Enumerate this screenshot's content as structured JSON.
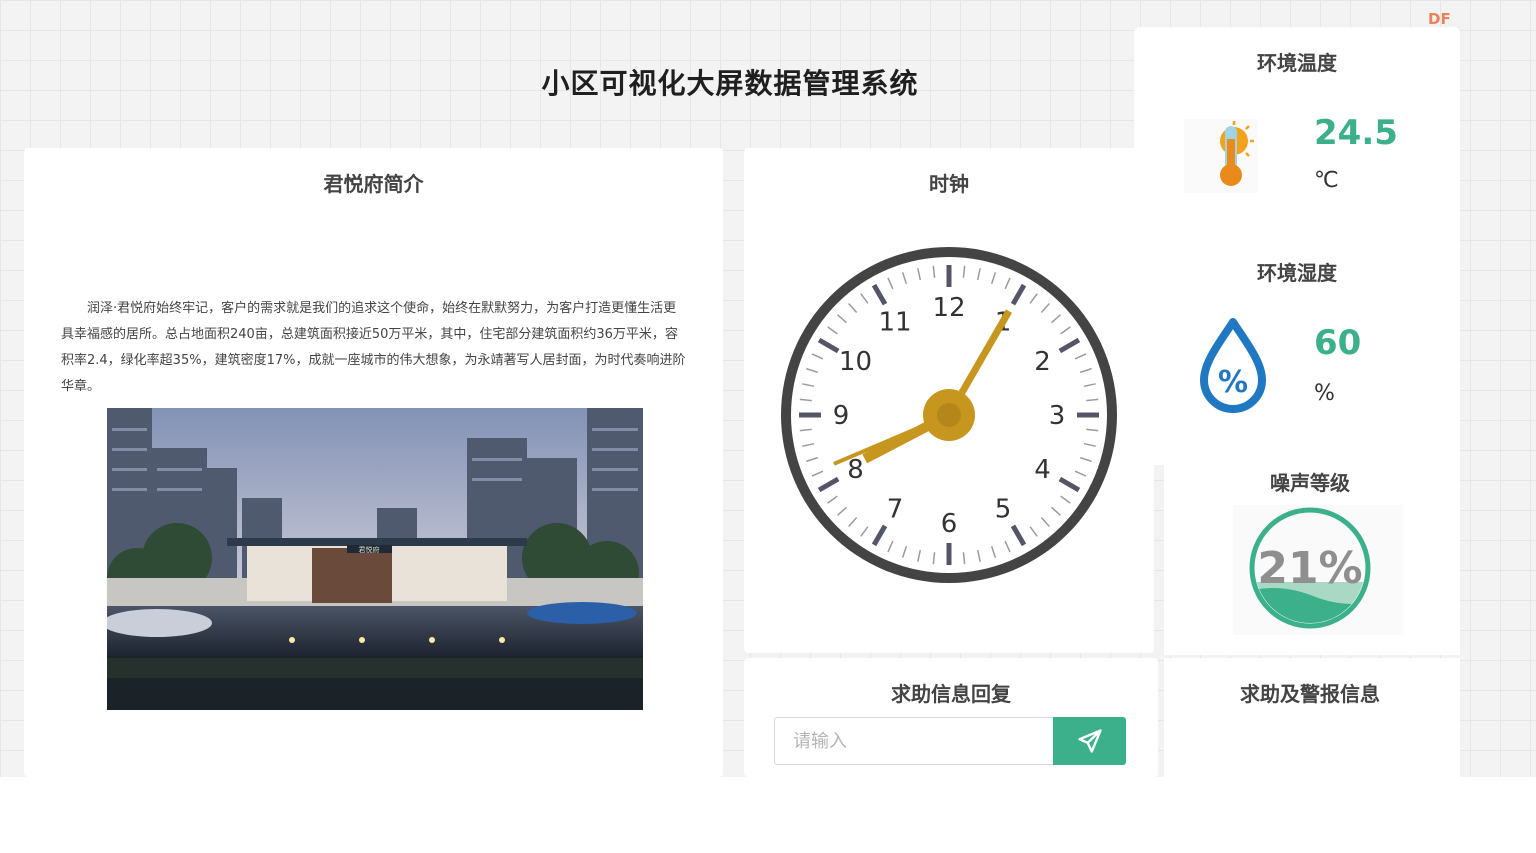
{
  "page": {
    "title": "小区可视化大屏数据管理系统",
    "badge": "DF"
  },
  "intro": {
    "title": "君悦府简介",
    "text": "润泽·君悦府始终牢记，客户的需求就是我们的追求这个使命，始终在默默努力，为客户打造更懂生活更具幸福感的居所。总占地面积240亩，总建筑面积接近50万平米，其中，住宅部分建筑面积约36万平米，容积率2.4，绿化率超35%，建筑密度17%，成就一座城市的伟大想象，为永靖著写人居封面，为时代奏响进阶华章。",
    "photo_sign": "君悦府"
  },
  "clock": {
    "title": "时钟",
    "numbers": [
      "12",
      "1",
      "2",
      "3",
      "4",
      "5",
      "6",
      "7",
      "8",
      "9",
      "10",
      "11"
    ],
    "time": {
      "hour": 8,
      "minute": 5
    },
    "colors": {
      "hand": "#c7961e",
      "rim": "#444444"
    }
  },
  "environment": {
    "temperature": {
      "title": "环境温度",
      "value": "24.5",
      "unit": "℃",
      "icon": "thermometer-icon"
    },
    "humidity": {
      "title": "环境湿度",
      "value": "60",
      "unit": "%",
      "icon": "water-drop-icon"
    },
    "noise": {
      "title": "噪声等级",
      "value_label": "21%",
      "level": 0.21
    }
  },
  "reply": {
    "title": "求助信息回复",
    "placeholder": "请输入",
    "send_icon": "send-icon"
  },
  "alerts": {
    "title": "求助及警报信息"
  },
  "colors": {
    "accent": "#3bb08a",
    "gold": "#c7961e",
    "badge": "#e8825a",
    "drop": "#1f78c1"
  }
}
